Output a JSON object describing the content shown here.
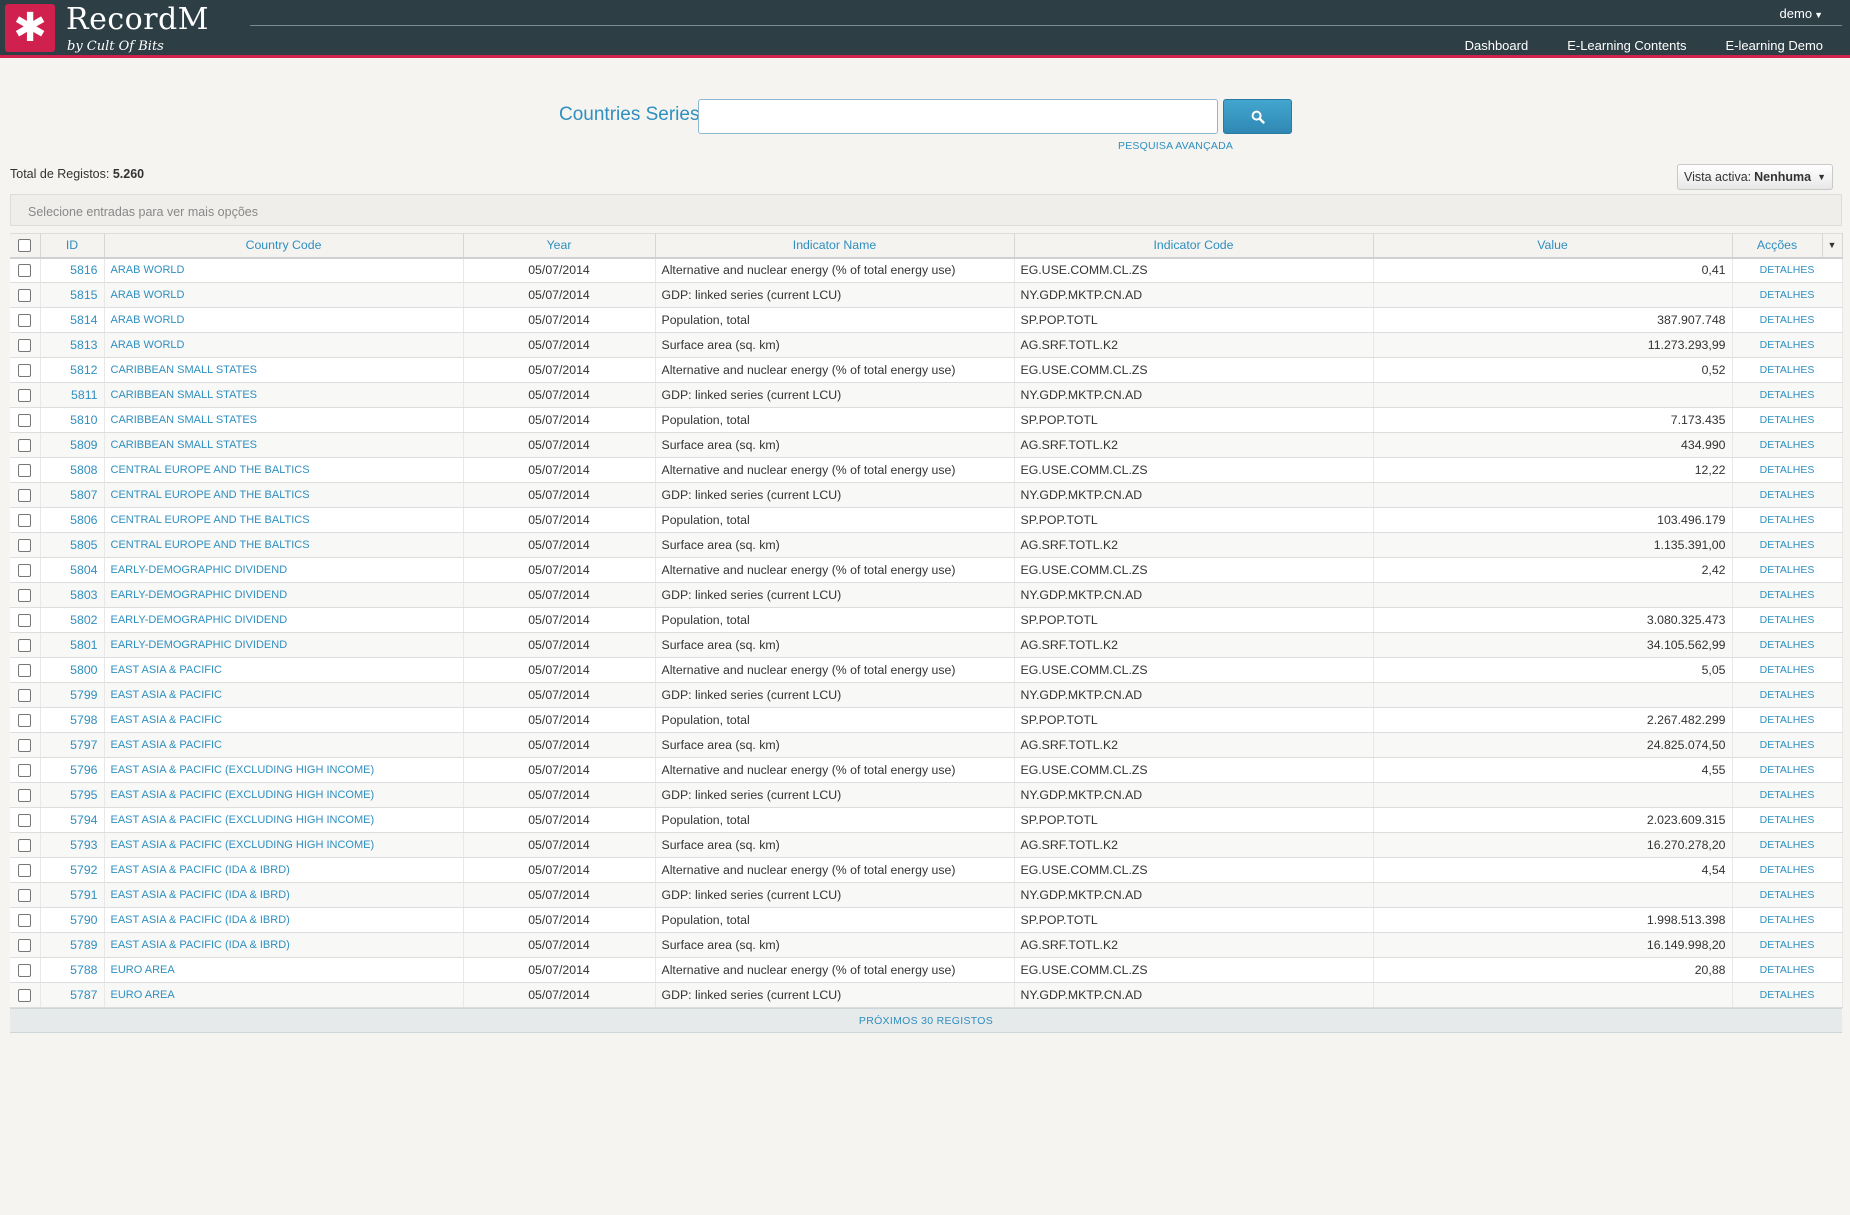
{
  "brand": {
    "title": "RecordM",
    "subtitle": "by Cult Of Bits",
    "logo_glyph": "✱"
  },
  "user": {
    "name": "demo"
  },
  "nav": [
    "Dashboard",
    "E-Learning Contents",
    "E-learning Demo"
  ],
  "search": {
    "label": "Countries Series",
    "value": "",
    "placeholder": "",
    "button_icon": "search-icon",
    "advanced_label": "PESQUISA AVANÇADA"
  },
  "totals": {
    "label": "Total de Registos:",
    "value": "5.260"
  },
  "view": {
    "label": "Vista activa:",
    "value": "Nenhuma"
  },
  "selection_hint": "Selecione entradas para ver mais opções",
  "table": {
    "columns": [
      "ID",
      "Country Code",
      "Year",
      "Indicator Name",
      "Indicator Code",
      "Value",
      "Acções"
    ],
    "action_label": "DETALHES",
    "rows": [
      [
        "5816",
        "ARAB WORLD",
        "05/07/2014",
        "Alternative and nuclear energy (% of total energy use)",
        "EG.USE.COMM.CL.ZS",
        "0,41"
      ],
      [
        "5815",
        "ARAB WORLD",
        "05/07/2014",
        "GDP: linked series (current LCU)",
        "NY.GDP.MKTP.CN.AD",
        ""
      ],
      [
        "5814",
        "ARAB WORLD",
        "05/07/2014",
        "Population, total",
        "SP.POP.TOTL",
        "387.907.748"
      ],
      [
        "5813",
        "ARAB WORLD",
        "05/07/2014",
        "Surface area (sq. km)",
        "AG.SRF.TOTL.K2",
        "11.273.293,99"
      ],
      [
        "5812",
        "CARIBBEAN SMALL STATES",
        "05/07/2014",
        "Alternative and nuclear energy (% of total energy use)",
        "EG.USE.COMM.CL.ZS",
        "0,52"
      ],
      [
        "5811",
        "CARIBBEAN SMALL STATES",
        "05/07/2014",
        "GDP: linked series (current LCU)",
        "NY.GDP.MKTP.CN.AD",
        ""
      ],
      [
        "5810",
        "CARIBBEAN SMALL STATES",
        "05/07/2014",
        "Population, total",
        "SP.POP.TOTL",
        "7.173.435"
      ],
      [
        "5809",
        "CARIBBEAN SMALL STATES",
        "05/07/2014",
        "Surface area (sq. km)",
        "AG.SRF.TOTL.K2",
        "434.990"
      ],
      [
        "5808",
        "CENTRAL EUROPE AND THE BALTICS",
        "05/07/2014",
        "Alternative and nuclear energy (% of total energy use)",
        "EG.USE.COMM.CL.ZS",
        "12,22"
      ],
      [
        "5807",
        "CENTRAL EUROPE AND THE BALTICS",
        "05/07/2014",
        "GDP: linked series (current LCU)",
        "NY.GDP.MKTP.CN.AD",
        ""
      ],
      [
        "5806",
        "CENTRAL EUROPE AND THE BALTICS",
        "05/07/2014",
        "Population, total",
        "SP.POP.TOTL",
        "103.496.179"
      ],
      [
        "5805",
        "CENTRAL EUROPE AND THE BALTICS",
        "05/07/2014",
        "Surface area (sq. km)",
        "AG.SRF.TOTL.K2",
        "1.135.391,00"
      ],
      [
        "5804",
        "EARLY-DEMOGRAPHIC DIVIDEND",
        "05/07/2014",
        "Alternative and nuclear energy (% of total energy use)",
        "EG.USE.COMM.CL.ZS",
        "2,42"
      ],
      [
        "5803",
        "EARLY-DEMOGRAPHIC DIVIDEND",
        "05/07/2014",
        "GDP: linked series (current LCU)",
        "NY.GDP.MKTP.CN.AD",
        ""
      ],
      [
        "5802",
        "EARLY-DEMOGRAPHIC DIVIDEND",
        "05/07/2014",
        "Population, total",
        "SP.POP.TOTL",
        "3.080.325.473"
      ],
      [
        "5801",
        "EARLY-DEMOGRAPHIC DIVIDEND",
        "05/07/2014",
        "Surface area (sq. km)",
        "AG.SRF.TOTL.K2",
        "34.105.562,99"
      ],
      [
        "5800",
        "EAST ASIA & PACIFIC",
        "05/07/2014",
        "Alternative and nuclear energy (% of total energy use)",
        "EG.USE.COMM.CL.ZS",
        "5,05"
      ],
      [
        "5799",
        "EAST ASIA & PACIFIC",
        "05/07/2014",
        "GDP: linked series (current LCU)",
        "NY.GDP.MKTP.CN.AD",
        ""
      ],
      [
        "5798",
        "EAST ASIA & PACIFIC",
        "05/07/2014",
        "Population, total",
        "SP.POP.TOTL",
        "2.267.482.299"
      ],
      [
        "5797",
        "EAST ASIA & PACIFIC",
        "05/07/2014",
        "Surface area (sq. km)",
        "AG.SRF.TOTL.K2",
        "24.825.074,50"
      ],
      [
        "5796",
        "EAST ASIA & PACIFIC (EXCLUDING HIGH INCOME)",
        "05/07/2014",
        "Alternative and nuclear energy (% of total energy use)",
        "EG.USE.COMM.CL.ZS",
        "4,55"
      ],
      [
        "5795",
        "EAST ASIA & PACIFIC (EXCLUDING HIGH INCOME)",
        "05/07/2014",
        "GDP: linked series (current LCU)",
        "NY.GDP.MKTP.CN.AD",
        ""
      ],
      [
        "5794",
        "EAST ASIA & PACIFIC (EXCLUDING HIGH INCOME)",
        "05/07/2014",
        "Population, total",
        "SP.POP.TOTL",
        "2.023.609.315"
      ],
      [
        "5793",
        "EAST ASIA & PACIFIC (EXCLUDING HIGH INCOME)",
        "05/07/2014",
        "Surface area (sq. km)",
        "AG.SRF.TOTL.K2",
        "16.270.278,20"
      ],
      [
        "5792",
        "EAST ASIA & PACIFIC (IDA & IBRD)",
        "05/07/2014",
        "Alternative and nuclear energy (% of total energy use)",
        "EG.USE.COMM.CL.ZS",
        "4,54"
      ],
      [
        "5791",
        "EAST ASIA & PACIFIC (IDA & IBRD)",
        "05/07/2014",
        "GDP: linked series (current LCU)",
        "NY.GDP.MKTP.CN.AD",
        ""
      ],
      [
        "5790",
        "EAST ASIA & PACIFIC (IDA & IBRD)",
        "05/07/2014",
        "Population, total",
        "SP.POP.TOTL",
        "1.998.513.398"
      ],
      [
        "5789",
        "EAST ASIA & PACIFIC (IDA & IBRD)",
        "05/07/2014",
        "Surface area (sq. km)",
        "AG.SRF.TOTL.K2",
        "16.149.998,20"
      ],
      [
        "5788",
        "EURO AREA",
        "05/07/2014",
        "Alternative and nuclear energy (% of total energy use)",
        "EG.USE.COMM.CL.ZS",
        "20,88"
      ],
      [
        "5787",
        "EURO AREA",
        "05/07/2014",
        "GDP: linked series (current LCU)",
        "NY.GDP.MKTP.CN.AD",
        ""
      ]
    ]
  },
  "pagination": {
    "next_label": "PRÓXIMOS 30 REGISTOS"
  },
  "colors": {
    "header_bg": "#2d3e45",
    "accent": "#d0214e",
    "link": "#2f8fc0",
    "button": "#3897c1"
  }
}
